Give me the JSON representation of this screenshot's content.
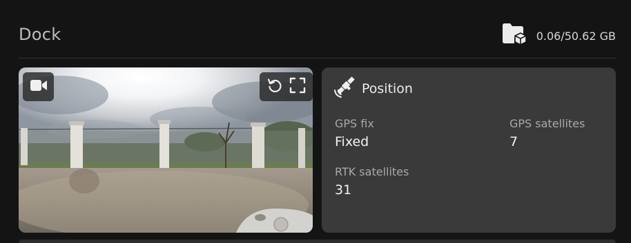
{
  "header": {
    "title": "Dock",
    "storage_icon": "folder-storage-icon",
    "storage_text": "0.06/50.62 GB"
  },
  "camera": {
    "camera_icon": "video-camera-icon",
    "refresh_icon": "refresh-icon",
    "fullscreen_icon": "fullscreen-icon"
  },
  "position": {
    "icon": "satellite-icon",
    "title": "Position",
    "gps_fix_label": "GPS fix",
    "gps_fix_value": "Fixed",
    "gps_satellites_label": "GPS satellites",
    "gps_satellites_value": "7",
    "rtk_satellites_label": "RTK satellites",
    "rtk_satellites_value": "31"
  },
  "colors": {
    "background": "#141414",
    "card": "#3a3a3a",
    "text_primary": "#f2f2f2",
    "text_secondary": "#a9a9a9"
  }
}
